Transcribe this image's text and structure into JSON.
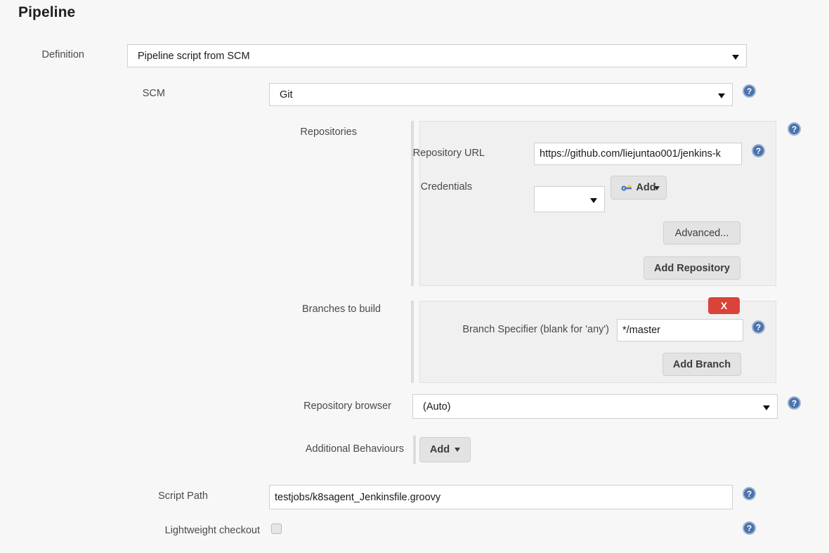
{
  "page": {
    "title": "Pipeline"
  },
  "definition": {
    "label": "Definition",
    "value": "Pipeline script from SCM"
  },
  "scm": {
    "label": "SCM",
    "value": "Git",
    "help_icon": "?"
  },
  "repositories": {
    "label": "Repositories",
    "help_icon": "?",
    "repository_url": {
      "label": "Repository URL",
      "value": "https://github.com/liejuntao001/jenkins-k",
      "help_icon": "?"
    },
    "credentials": {
      "label": "Credentials",
      "value": "",
      "add_button": {
        "label": "Add",
        "icon": "key-icon"
      }
    },
    "advanced_button": "Advanced...",
    "add_repository_button": "Add Repository"
  },
  "branches": {
    "label": "Branches to build",
    "delete_button": "X",
    "branch_specifier": {
      "label": "Branch Specifier (blank for 'any')",
      "value": "*/master",
      "help_icon": "?"
    },
    "add_branch_button": "Add Branch"
  },
  "repository_browser": {
    "label": "Repository browser",
    "value": "(Auto)",
    "help_icon": "?"
  },
  "additional_behaviours": {
    "label": "Additional Behaviours",
    "add_button": "Add"
  },
  "script_path": {
    "label": "Script Path",
    "value": "testjobs/k8sagent_Jenkinsfile.groovy",
    "help_icon": "?"
  },
  "lightweight_checkout": {
    "label": "Lightweight checkout",
    "checked": false,
    "help_icon": "?"
  },
  "colors": {
    "page_background": "#f7f7f7",
    "panel_background": "#f0f0f0",
    "help_icon": "#4a73ad",
    "delete_button": "#d9433a",
    "button_face": "#e3e3e3"
  }
}
